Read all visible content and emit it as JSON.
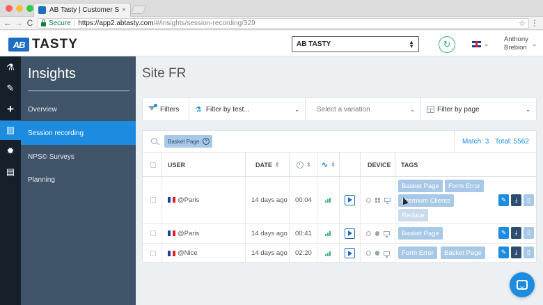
{
  "browser": {
    "tab_title": "AB Tasty | Customer Service",
    "tab_close": "×",
    "secure_label": "Secure",
    "url_host": "https://app2.abtasty.com",
    "url_path": "/#/insights/session-recording/329",
    "back": "←",
    "forward": "→",
    "reload": "C",
    "star": "☆",
    "menu": "⋮",
    "traffic_colors": [
      "#fc605c",
      "#fdbc40",
      "#34c84a"
    ]
  },
  "header": {
    "logo_mark": "AB",
    "logo_text": "TASTY",
    "account": "AB TASTY",
    "refresh_icon": "↻",
    "user_first": "Anthony",
    "user_last": "Brebion",
    "chevron": "⌄"
  },
  "iconbar": {
    "items": [
      {
        "name": "flask-icon",
        "glyph": "⚗"
      },
      {
        "name": "brush-icon",
        "glyph": "✎"
      },
      {
        "name": "plus-icon",
        "glyph": "+"
      },
      {
        "name": "chart-icon",
        "glyph": "▥",
        "active": true
      },
      {
        "name": "gear-icon",
        "glyph": "✹"
      },
      {
        "name": "book-icon",
        "glyph": "▤"
      }
    ]
  },
  "sidebar": {
    "title": "Insights",
    "items": [
      {
        "label": "Overview"
      },
      {
        "label": "Session recording",
        "active": true
      },
      {
        "label": "NPS© Surveys"
      },
      {
        "label": "Planning"
      }
    ]
  },
  "main": {
    "title": "Site FR",
    "filters": {
      "filters_label": "Filters",
      "test_label": "Filter by test...",
      "variation_placeholder": "Select a variation",
      "page_label": "Filter by page"
    },
    "chip": "Basket Page",
    "match_label": "Match: 3",
    "total_label": "Total: 5562",
    "columns": {
      "user": "USER",
      "date": "DATE",
      "device": "DEVICE",
      "tags": "TAGS"
    },
    "rows": [
      {
        "user": "@Paris",
        "date": "14 days ago",
        "duration": "00:04",
        "tags": [
          "Basket Page",
          "Form Error",
          "Premium Clients",
          "Reduce"
        ]
      },
      {
        "user": "@Paris",
        "date": "14 days ago",
        "duration": "00:41",
        "tags": [
          "Basket Page"
        ]
      },
      {
        "user": "@Nice",
        "date": "14 days ago",
        "duration": "02:20",
        "tags": [
          "Form Error",
          "Basket Page"
        ]
      }
    ]
  },
  "colors": {
    "accent": "#1d8ce0",
    "sidebar": "#3f5469",
    "iconbar": "#16202b",
    "tag": "#a7c8e6",
    "signal": "#3cb371"
  }
}
